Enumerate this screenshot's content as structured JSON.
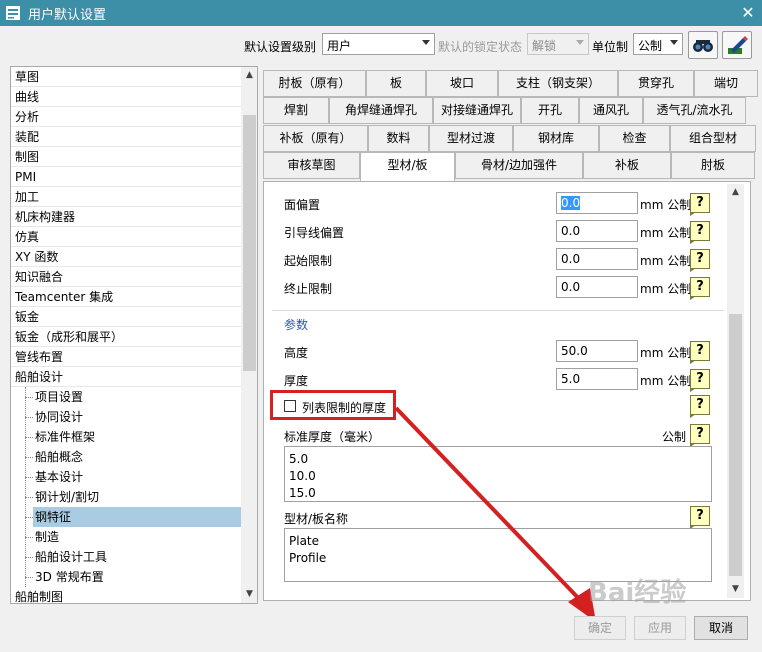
{
  "window": {
    "title": "用户默认设置",
    "close_glyph": "✕"
  },
  "toolbar": {
    "level_label": "默认设置级别",
    "level_value": "用户",
    "lock_label": "默认的锁定状态",
    "lock_value": "解锁",
    "unit_label": "单位制",
    "unit_value": "公制",
    "icons": [
      "search-binoculars-icon",
      "edit-settings-icon"
    ]
  },
  "tree": {
    "items": [
      {
        "label": "草图",
        "level": 0
      },
      {
        "label": "曲线",
        "level": 0
      },
      {
        "label": "分析",
        "level": 0
      },
      {
        "label": "装配",
        "level": 0
      },
      {
        "label": "制图",
        "level": 0
      },
      {
        "label": "PMI",
        "level": 0
      },
      {
        "label": "加工",
        "level": 0
      },
      {
        "label": "机床构建器",
        "level": 0
      },
      {
        "label": "仿真",
        "level": 0
      },
      {
        "label": "XY 函数",
        "level": 0
      },
      {
        "label": "知识融合",
        "level": 0
      },
      {
        "label": "Teamcenter 集成",
        "level": 0
      },
      {
        "label": "钣金",
        "level": 0
      },
      {
        "label": "钣金（成形和展平）",
        "level": 0
      },
      {
        "label": "管线布置",
        "level": 0
      },
      {
        "label": "船舶设计",
        "level": 0
      },
      {
        "label": "项目设置",
        "level": 1
      },
      {
        "label": "协同设计",
        "level": 1
      },
      {
        "label": "标准件框架",
        "level": 1
      },
      {
        "label": "船舶概念",
        "level": 1
      },
      {
        "label": "基本设计",
        "level": 1
      },
      {
        "label": "钢计划/割切",
        "level": 1
      },
      {
        "label": "钢特征",
        "level": 1,
        "selected": true
      },
      {
        "label": "制造",
        "level": 1
      },
      {
        "label": "船舶设计工具",
        "level": 1
      },
      {
        "label": "3D 常规布置",
        "level": 1
      },
      {
        "label": "船舶制图",
        "level": 0
      }
    ]
  },
  "tabs": {
    "row1": [
      "肘板（原有）",
      "板",
      "坡口",
      "支柱（钢支架）",
      "贯穿孔",
      "端切"
    ],
    "row2": [
      "焊割",
      "角焊缝通焊孔",
      "对接缝通焊孔",
      "开孔",
      "通风孔",
      "透气孔/流水孔"
    ],
    "row3": [
      "补板（原有）",
      "数料",
      "型材过渡",
      "钢材库",
      "检查",
      "组合型材"
    ],
    "row4": [
      "审核草图",
      "型材/板",
      "骨材/边加强件",
      "补板",
      "肘板"
    ],
    "active": "型材/板"
  },
  "form": {
    "rows_top": [
      {
        "label": "面偏置",
        "value": "0.0",
        "unit": "mm 公制"
      },
      {
        "label": "引导线偏置",
        "value": "0.0",
        "unit": "mm 公制"
      },
      {
        "label": "起始限制",
        "value": "0.0",
        "unit": "mm 公制"
      },
      {
        "label": "终止限制",
        "value": "0.0",
        "unit": "mm 公制"
      }
    ],
    "params_title": "参数",
    "rows_params": [
      {
        "label": "高度",
        "value": "50.0",
        "unit": "mm 公制"
      },
      {
        "label": "厚度",
        "value": "5.0",
        "unit": "mm 公制"
      }
    ],
    "checkbox_label": "列表限制的厚度",
    "checkbox_checked": false,
    "std_thickness_label": "标准厚度（毫米）",
    "std_thickness_unit": "公制",
    "std_thickness_values": [
      "5.0",
      "10.0",
      "15.0"
    ],
    "name_label": "型材/板名称",
    "name_values": [
      "Plate",
      "Profile"
    ],
    "help_glyph": "?"
  },
  "buttons": {
    "ok": "确定",
    "apply": "应用",
    "cancel": "取消"
  },
  "annotation_color": "#d42020"
}
